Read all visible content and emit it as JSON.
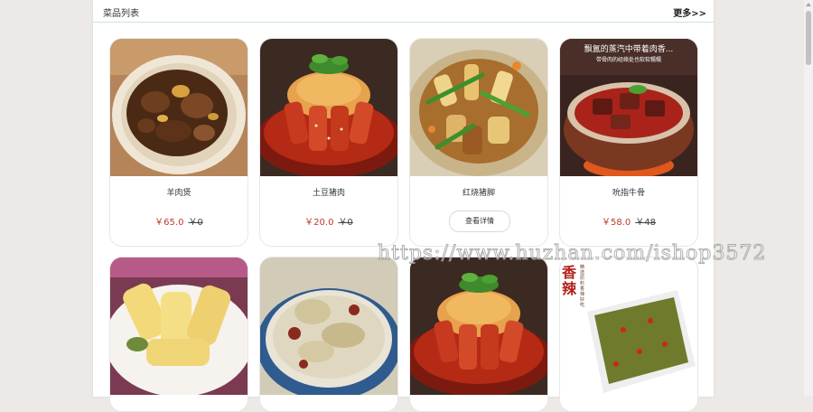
{
  "panel": {
    "title": "菜品列表",
    "more": "更多>>"
  },
  "dishes": [
    {
      "name": "羊肉煲",
      "price": "￥65.0",
      "orig_price": "￥0"
    },
    {
      "name": "土豆猪肉",
      "price": "￥20.0",
      "orig_price": "￥0"
    },
    {
      "name": "红烧猪脚",
      "detail_button": "查看详情"
    },
    {
      "name": "吮指牛骨",
      "price": "￥58.0",
      "orig_price": "￥48"
    },
    {
      "name": ""
    },
    {
      "name": ""
    },
    {
      "name": ""
    },
    {
      "name": ""
    }
  ],
  "photo_captions": {
    "beef_pot_line1": "飘氲的蒸汽中带着肉香...",
    "beef_pot_line2": "带骨肉的经络处也软软糯糯",
    "pickle_big": "香辣",
    "pickle_small": "精选原料 香辣好吃"
  },
  "watermark": "https://www.huzhan.com/ishop3572",
  "colors": {
    "price": "#c0392b",
    "header_line": "#c7e4e0",
    "background": "#ece9e6"
  }
}
